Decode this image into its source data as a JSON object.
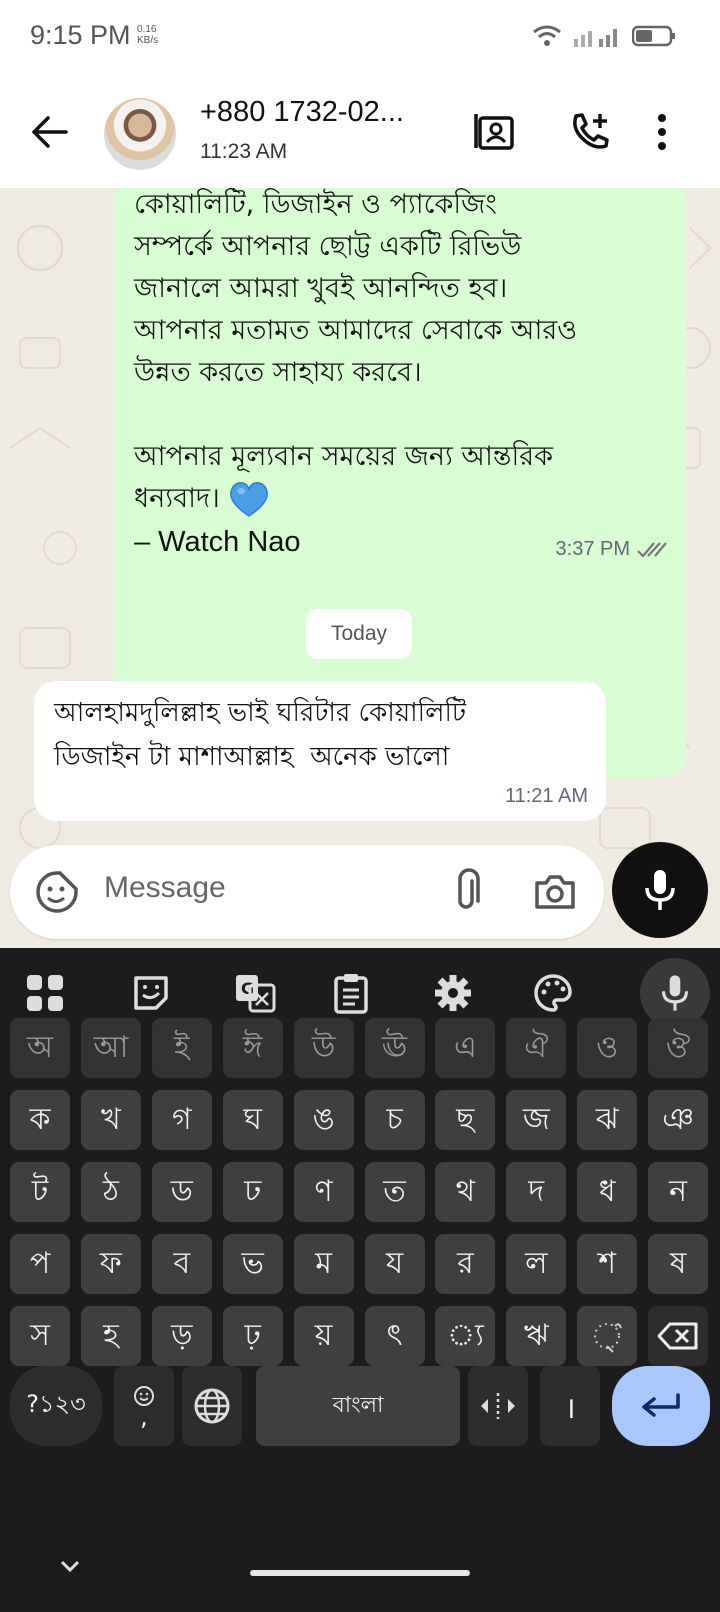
{
  "status_bar": {
    "time": "9:15 PM",
    "speed_value": "0.16",
    "speed_unit": "KB/s",
    "icons": [
      "wifi-icon",
      "signal-icon",
      "battery-icon"
    ]
  },
  "header": {
    "contact_name": "+880 1732-02...",
    "last_seen": "11:23 AM",
    "icons": [
      "back-arrow-icon",
      "contact-card-icon",
      "add-call-icon",
      "more-vert-icon"
    ]
  },
  "chat": {
    "outgoing": {
      "text": "কোয়ালিটি, ডিজাইন ও প্যাকেজিং\nসম্পর্কে আপনার ছোট্ট একটি রিভিউ\nজানালে আমরা খুবই আনন্দিত হব।\nআপনার মতামত আমাদের সেবাকে আরও\nউন্নত করতে সাহায্য করবে।\n\nআপনার মূল্যবান সময়ের জন্য আন্তরিক\nধন্যবাদ।",
      "signature": "– Watch Nao",
      "time": "3:37 PM",
      "emoji": "blue-heart-icon",
      "status": "read-ticks-icon"
    },
    "date_divider": "Today",
    "incoming": {
      "text": "আলহামদুলিল্লাহ ভাই ঘরিটার কোয়ালিটি\nডিজাইন টা মাশাআল্লাহ  অনেক ভালো",
      "time": "11:21 AM"
    }
  },
  "composer": {
    "placeholder": "Message",
    "icons": [
      "sticker-icon",
      "attach-icon",
      "camera-icon",
      "mic-icon"
    ]
  },
  "keyboard": {
    "toolbar_icons": [
      "apps-grid-icon",
      "sticker-icon",
      "translate-icon",
      "clipboard-icon",
      "settings-icon",
      "palette-icon",
      "mic-icon"
    ],
    "row1": [
      "অ",
      "আ",
      "ই",
      "ঈ",
      "উ",
      "ঊ",
      "এ",
      "ঐ",
      "ও",
      "ঔ"
    ],
    "row2": [
      "ক",
      "খ",
      "গ",
      "ঘ",
      "ঙ",
      "চ",
      "ছ",
      "জ",
      "ঝ",
      "ঞ"
    ],
    "row3": [
      "ট",
      "ঠ",
      "ড",
      "ঢ",
      "ণ",
      "ত",
      "থ",
      "দ",
      "ধ",
      "ন"
    ],
    "row4": [
      "প",
      "ফ",
      "ব",
      "ভ",
      "ম",
      "য",
      "র",
      "ল",
      "শ",
      "ষ"
    ],
    "row5": [
      "স",
      "হ",
      "ড়",
      "ঢ়",
      "য়",
      "ৎ",
      "্য",
      "ঋ"
    ],
    "symbols_label": "?১২৩",
    "emoji_comma_label": ",",
    "space_label": "বাংলা",
    "danda_label": "।",
    "accent_color": "#a8c7fa"
  }
}
